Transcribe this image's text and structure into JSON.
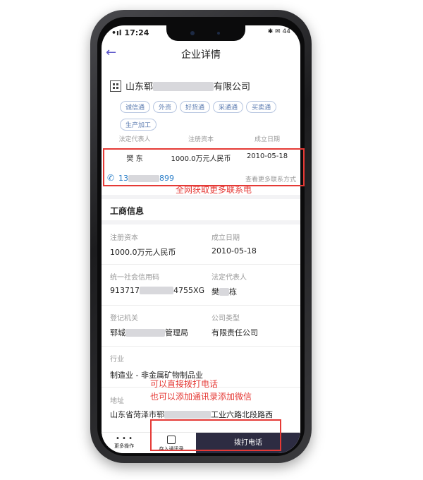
{
  "status_bar": {
    "time": "17:24",
    "signal": "•ıl",
    "icons": "✱ ✉ 44"
  },
  "header": {
    "back_icon": "back-arrow-icon",
    "title": "企业详情"
  },
  "company": {
    "name_prefix": "山东郓",
    "name_suffix": "有限公司"
  },
  "tags": [
    "诚信通",
    "外资",
    "好货通",
    "采通通",
    "买卖通",
    "生产加工"
  ],
  "summary": {
    "legal_rep_label": "法定代表人",
    "legal_rep_value": "樊  东",
    "capital_label": "注册资本",
    "capital_value": "1000.0万元人民币",
    "date_label": "成立日期",
    "date_value": "2010-05-18"
  },
  "phone": {
    "prefix": "13",
    "suffix": "899",
    "more": "查看更多联系方式"
  },
  "annotation_top": "全网获取更多联系电",
  "section_title": "工商信息",
  "fields": {
    "capital_label": "注册资本",
    "capital_value": "1000.0万元人民币",
    "date_label": "成立日期",
    "date_value": "2010-05-18",
    "credit_label": "统一社会信用码",
    "credit_prefix": "913717",
    "credit_suffix": "4755XG",
    "legal_label": "法定代表人",
    "legal_prefix": "樊",
    "legal_suffix": "栋",
    "authority_label": "登记机关",
    "authority_prefix": "郓城",
    "authority_suffix": "管理局",
    "type_label": "公司类型",
    "type_value": "有限责任公司",
    "industry_label": "行业",
    "industry_value": "制造业 - 非金属矿物制品业",
    "address_label": "地址",
    "address_prefix": "山东省菏泽市郓",
    "address_suffix": "工业六路北段路西"
  },
  "annotation_bottom": [
    "可以直接拨打电话",
    "也可以添加通讯录添加微信"
  ],
  "bottom_bar": {
    "more_label": "更多操作",
    "contacts_label": "存入通讯录",
    "call_label": "拨打电话"
  }
}
